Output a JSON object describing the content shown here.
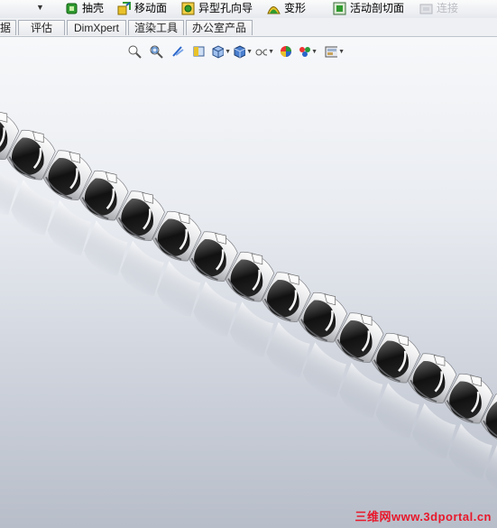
{
  "toolbar": {
    "items": [
      {
        "label": "抽壳"
      },
      {
        "label": "移动面"
      },
      {
        "label": "异型孔向导"
      },
      {
        "label": "变形"
      },
      {
        "label": "活动剖切面"
      },
      {
        "label": "连接"
      }
    ]
  },
  "tabs": [
    {
      "label": "据"
    },
    {
      "label": "评估"
    },
    {
      "label": "DimXpert"
    },
    {
      "label": "渲染工具"
    },
    {
      "label": "办公室产品"
    }
  ],
  "headsup_icons": [
    "zoom-to-fit-icon",
    "zoom-area-icon",
    "previous-view-icon",
    "section-view-icon",
    "view-orientation-icon",
    "display-style-icon",
    "hide-show-items-icon",
    "edit-appearance-icon",
    "apply-scene-icon",
    "view-settings-icon"
  ],
  "colors": {
    "accent_green": "#2f9a2f",
    "accent_yellow": "#e9c22a",
    "watermark_red": "#e8182b"
  },
  "watermark": {
    "text": "三维网www.3dportal.cn"
  }
}
